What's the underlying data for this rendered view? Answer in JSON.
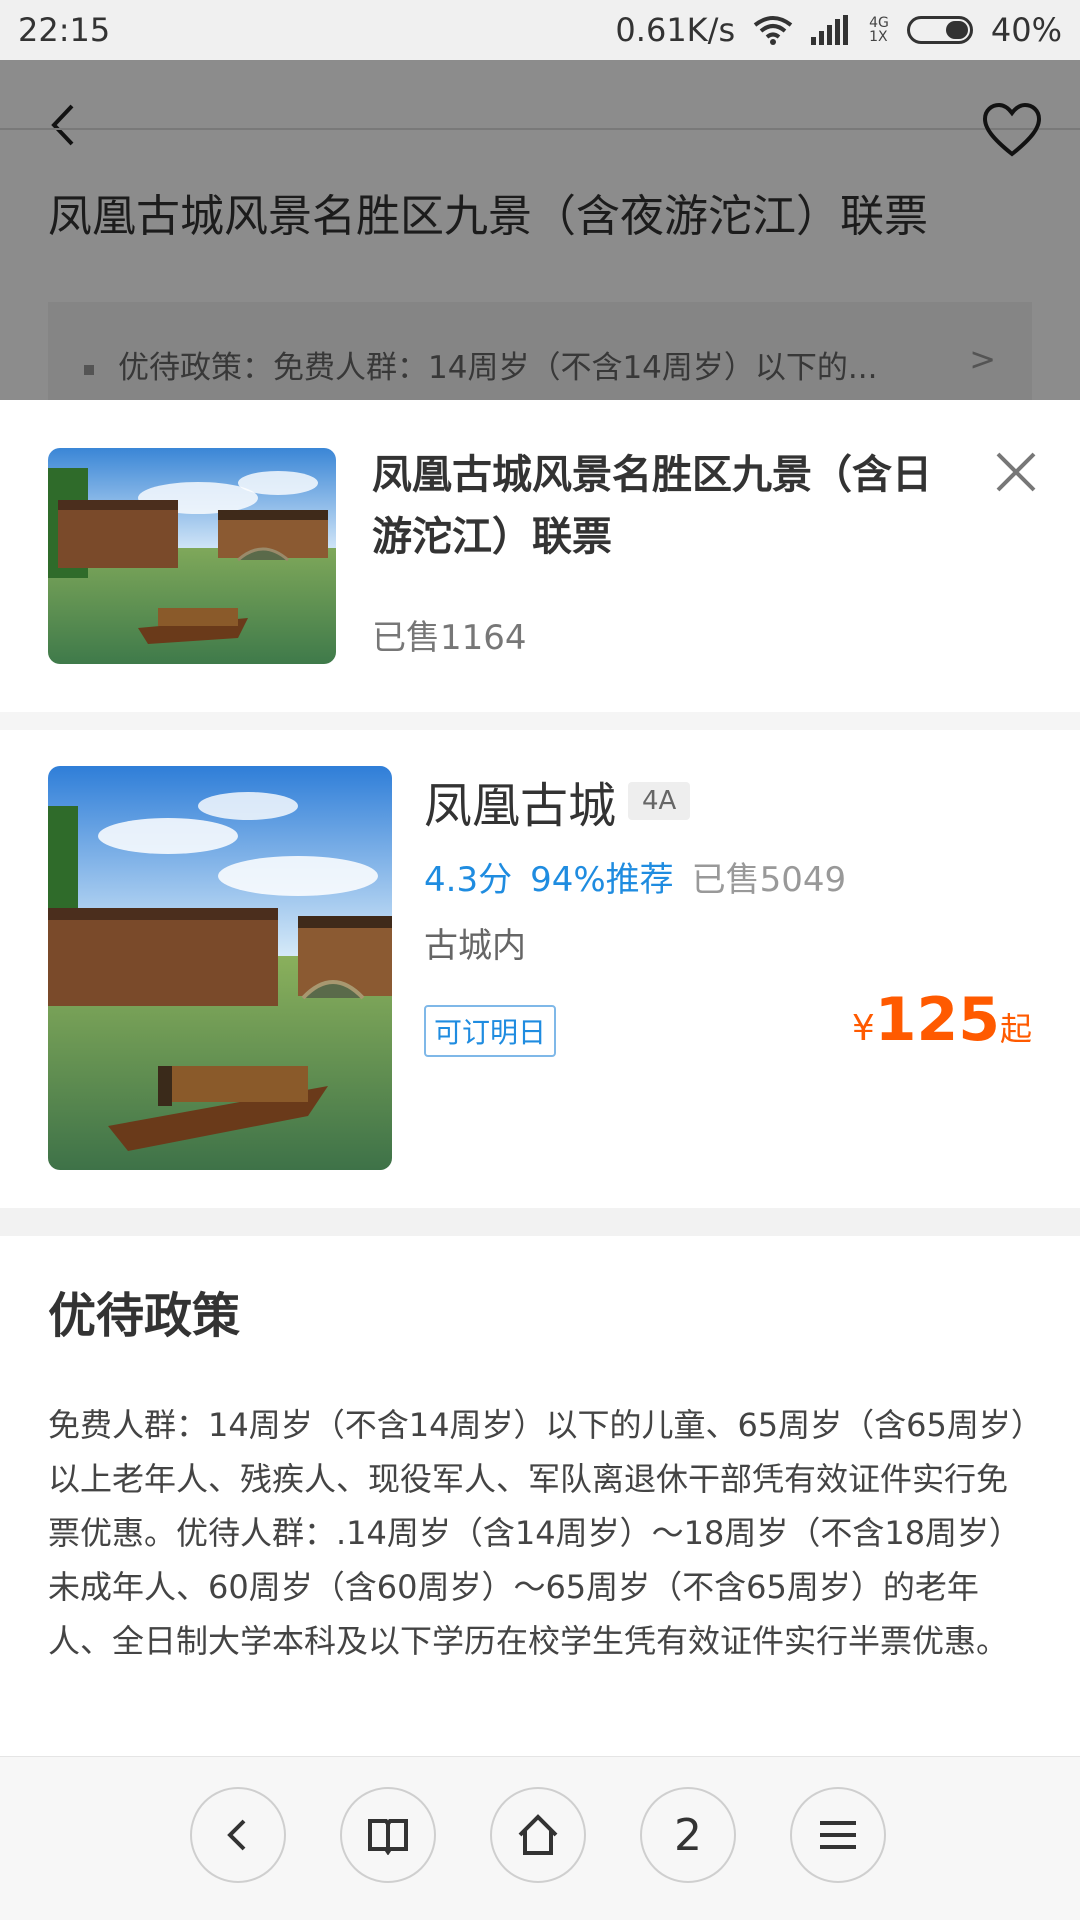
{
  "status_bar": {
    "time": "22:15",
    "speed": "0.61K/s",
    "net_top": "4G",
    "net_bottom": "1X",
    "battery": "40%",
    "battery_level": 0.4
  },
  "background_page": {
    "title": "凤凰古城风景名胜区九景（含夜游沱江）联票",
    "policy_preview": "优待政策：免费人群：14周岁（不含14周岁）以下的..."
  },
  "sheet": {
    "title": "凤凰古城风景名胜区九景（含日游沱江）联票",
    "sold": "已售1164"
  },
  "scenic": {
    "name": "凤凰古城",
    "level": "4A",
    "score": "4.3分",
    "recommend": "94%推荐",
    "sold": "已售5049",
    "location": "古城内",
    "tag": "可订明日",
    "currency": "¥",
    "price": "125",
    "price_suffix": "起"
  },
  "policy": {
    "heading": "优待政策",
    "text": "免费人群：14周岁（不含14周岁）以下的儿童、65周岁（含65周岁）以上老年人、残疾人、现役军人、军队离退休干部凭有效证件实行免票优惠。优待人群：.14周岁（含14周岁）～18周岁（不含18周岁）未成年人、60周岁（含60周岁）～65周岁（不含65周岁）的老年人、全日制大学本科及以下学历在校学生凭有效证件实行半票优惠。"
  },
  "bottom_bar": {
    "tab_count": "2",
    "icons": [
      "back-icon",
      "bookmarks-icon",
      "home-icon",
      "tabs-count",
      "menu-icon"
    ]
  },
  "colors": {
    "accent_blue": "#1f8ce0",
    "price_orange": "#ff5a00"
  }
}
